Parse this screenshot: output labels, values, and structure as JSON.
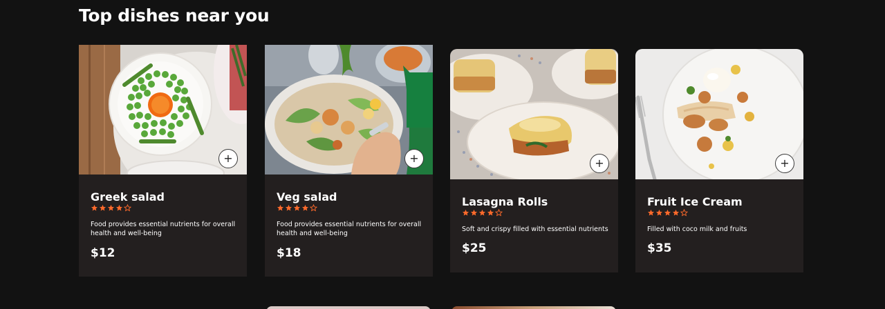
{
  "section": {
    "title": "Top dishes near you"
  },
  "accent_color": "#ff6a2b",
  "dishes": [
    {
      "name": "Greek salad",
      "rating": 4,
      "rating_max": 5,
      "description": "Food provides essential nutrients for overall health and well-being",
      "price": "$12",
      "add_icon": "plus-icon"
    },
    {
      "name": "Veg salad",
      "rating": 4,
      "rating_max": 5,
      "description": "Food provides essential nutrients for overall health and well-being",
      "price": "$18",
      "add_icon": "plus-icon"
    },
    {
      "name": "Lasagna Rolls",
      "rating": 4,
      "rating_max": 5,
      "description": "Soft and crispy filled with essential nutrients",
      "price": "$25",
      "add_icon": "plus-icon"
    },
    {
      "name": "Fruit Ice Cream",
      "rating": 4,
      "rating_max": 5,
      "description": "Filled with coco milk and fruits",
      "price": "$35",
      "add_icon": "plus-icon"
    }
  ]
}
